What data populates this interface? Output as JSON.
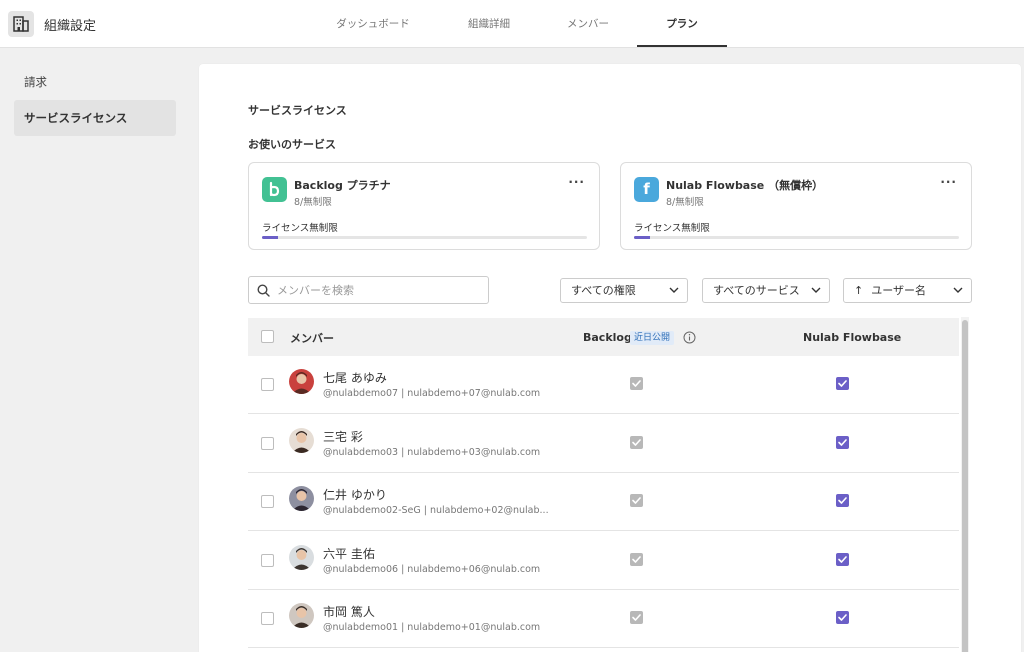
{
  "header": {
    "org_title": "組織設定",
    "tabs": [
      {
        "label": "ダッシュボード"
      },
      {
        "label": "組織詳細"
      },
      {
        "label": "メンバー"
      },
      {
        "label": "プラン",
        "active": true
      }
    ]
  },
  "sidebar": {
    "items": [
      {
        "label": "請求"
      },
      {
        "label": "サービスライセンス",
        "active": true
      }
    ]
  },
  "main": {
    "section_title": "サービスライセンス",
    "services_title": "お使いのサービス",
    "services": [
      {
        "icon": "backlog-logo-icon",
        "logo_letter": "b",
        "logo_color": "#42c193",
        "name": "Backlog プラチナ",
        "sub": "8/無制限",
        "license_label": "ライセンス無制限",
        "usage_fraction": 0.05
      },
      {
        "icon": "flowbase-logo-icon",
        "logo_letter": "f",
        "logo_color": "#4aa8dc",
        "name": "Nulab Flowbase （無償枠）",
        "sub": "8/無制限",
        "license_label": "ライセンス無制限",
        "usage_fraction": 0.05
      }
    ],
    "search_placeholder": "メンバーを検索",
    "filters": {
      "role": "すべての権限",
      "service": "すべてのサービス",
      "sort": "ユーザー名"
    },
    "table": {
      "headers": {
        "member": "メンバー",
        "backlog": "Backlog",
        "backlog_badge": "近日公開",
        "flowbase": "Nulab Flowbase"
      },
      "rows": [
        {
          "name": "七尾 あゆみ",
          "meta": "@nulabdemo07 | nulabdemo+07@nulab.com",
          "backlog": true,
          "flowbase": true,
          "avatar_bg": "#c9413d",
          "avatar_fg": "#5a2a22"
        },
        {
          "name": "三宅 彩",
          "meta": "@nulabdemo03 | nulabdemo+03@nulab.com",
          "backlog": true,
          "flowbase": true,
          "avatar_bg": "#e6ddd4",
          "avatar_fg": "#3a2a22"
        },
        {
          "name": "仁井 ゆかり",
          "meta": "@nulabdemo02-SeG | nulabdemo+02@nulab...",
          "backlog": true,
          "flowbase": true,
          "avatar_bg": "#8d8fa0",
          "avatar_fg": "#2b2530"
        },
        {
          "name": "六平 圭佑",
          "meta": "@nulabdemo06 | nulabdemo+06@nulab.com",
          "backlog": true,
          "flowbase": true,
          "avatar_bg": "#d9dde0",
          "avatar_fg": "#3b3430"
        },
        {
          "name": "市岡 篤人",
          "meta": "@nulabdemo01 | nulabdemo+01@nulab.com",
          "backlog": true,
          "flowbase": true,
          "avatar_bg": "#cfc7c0",
          "avatar_fg": "#3a2d26"
        }
      ]
    }
  },
  "colors": {
    "accent": "#6b5fc7",
    "backlog_green": "#42c193",
    "flowbase_blue": "#4aa8dc"
  }
}
